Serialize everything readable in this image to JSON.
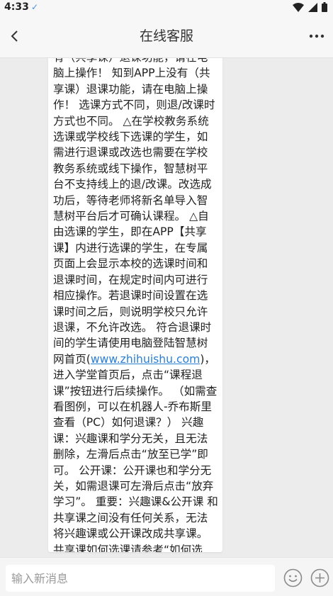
{
  "status_bar": {
    "time": "4:33",
    "check_icon": "check-icon"
  },
  "header": {
    "title": "在线客服",
    "back_icon": "back-arrow-icon",
    "more_icon": "more-dots-icon"
  },
  "message": {
    "part1": "有（共享课）退课功能，请在电脑上操作！ 知到APP上没有（共享课）退课功能，请在电脑上操作！ 选课方式不同，则退/改课时方式也不同。 △在学校教务系统选课或学校线下选课的学生，如需进行退课或改选也需要在学校教务系统或线下操作，智慧树平台不支持线上的退/改课。改选成功后，等待老师将新名单导入智慧树平台后才可确认课程。 △自由选课的学生，即在APP【共享课】内进行选课的学生，在专属页面上会显示本校的选课时间和退课时间，在规定时间内可进行相应操作。若退课时间设置在选课时间之后，则说明学校只允许退课，不允许改选。 符合退课时间的学生请使用电脑登陆智慧树网首页(",
    "link": "www.zhihuishu.com",
    "part2": ")，进入学堂首页后，点击“课程退课”按钮进行后续操作。 （如需查看图例，可以在机器人-乔布斯里查看（PC）如何退课？） 兴趣课：兴趣课和学分无关，且无法删除，左滑后点击“放至已学”即可。 公开课：公开课也和学分无关，如需退课可左滑后点击“放弃学习”。 重要：兴趣课&公开课 和共享课之间没有任何关系，无法将兴趣课或公开课改成共享课。共享课如何选课请参考“如何选课”！"
  },
  "input_bar": {
    "placeholder": "输入新消息"
  },
  "colors": {
    "link": "#2a7fd4",
    "background": "#ececec",
    "bubble": "#ffffff"
  }
}
